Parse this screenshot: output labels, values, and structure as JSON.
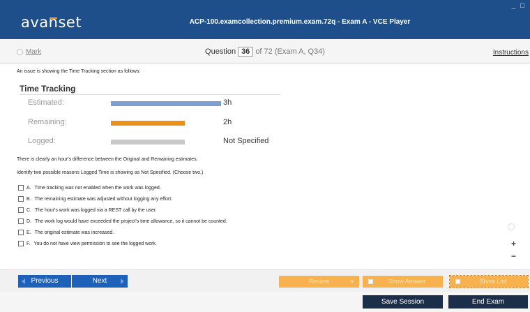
{
  "window": {
    "logo": "avanset",
    "title": "ACP-100.examcollection.premium.exam.72q - Exam A - VCE Player",
    "controls": "_ □"
  },
  "question_bar": {
    "mark_label": "Mark",
    "question_word": "Question",
    "question_number": "36",
    "question_of": "of 72 (Exam A, Q34)",
    "instructions_label": "Instructions"
  },
  "question": {
    "intro": "An issue is showing the Time Tracking section as follows:",
    "time_tracking": {
      "title": "Time Tracking",
      "rows": [
        {
          "label": "Estimated:",
          "value": "3h",
          "bar_fraction": 1.0,
          "color": "#7d9fcf"
        },
        {
          "label": "Remaining:",
          "value": "2h",
          "bar_fraction": 0.67,
          "color": "#e8921c"
        },
        {
          "label": "Logged:",
          "value": "Not Specified",
          "bar_fraction": 0.67,
          "color": "#c8c8c8"
        }
      ]
    },
    "statement": "There is clearly an hour's difference between the Original and Remaining estimates.",
    "prompt": "Identify two possible reasons Logged Time is showing as Not Specified. (Choose two.)",
    "options": [
      {
        "letter": "A.",
        "text": "Time tracking was not enabled when the work was logged."
      },
      {
        "letter": "B.",
        "text": "The remaining estimate was adjusted without logging any effort."
      },
      {
        "letter": "C.",
        "text": "The hour's work was logged via a REST call by the user."
      },
      {
        "letter": "D.",
        "text": "The work log would have exceeded the project's time allowance, so it cannot be counted."
      },
      {
        "letter": "E.",
        "text": "The original estimate was increased."
      },
      {
        "letter": "F.",
        "text": "You do not have view permission to see the logged work."
      }
    ]
  },
  "zoom": {
    "plus": "+",
    "minus": "−"
  },
  "nav": {
    "previous_label": "Previous",
    "next_label": "Next",
    "review_label": "Review",
    "show_answer_label": "Show Answer",
    "show_list_label": "Show List"
  },
  "footer": {
    "save_session_label": "Save Session",
    "end_exam_label": "End Exam"
  },
  "colors": {
    "titlebar": "#1f4f8a",
    "accent_orange": "#f7b24f",
    "button_blue": "#1d61b8",
    "button_dark": "#1b2e4a"
  }
}
